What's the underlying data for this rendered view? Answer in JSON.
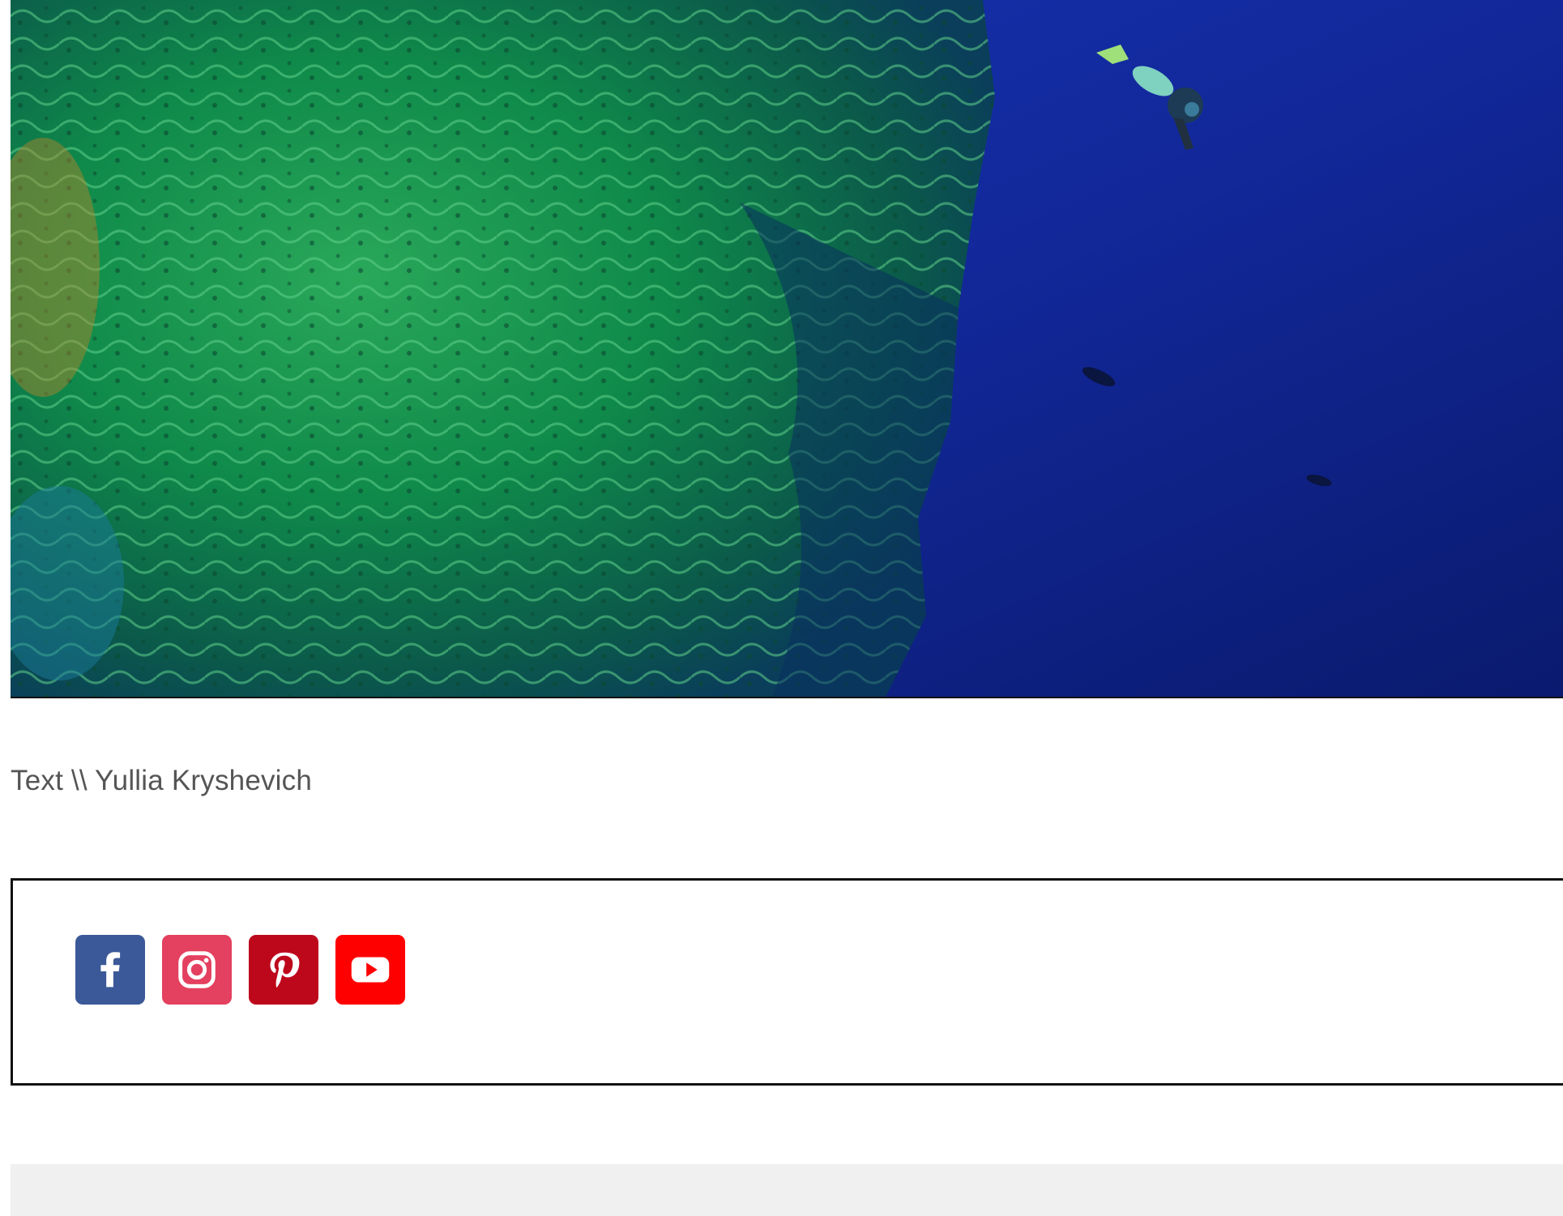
{
  "hero": {
    "alt": "Underwater coral reef wall with a scuba diver in deep blue water"
  },
  "credit": {
    "text": "Text \\\\ Yullia Kryshevich"
  },
  "social": {
    "items": [
      {
        "name": "facebook",
        "icon": "facebook-icon",
        "color": "#3b5998"
      },
      {
        "name": "instagram",
        "icon": "instagram-icon",
        "color": "#e4405f"
      },
      {
        "name": "pinterest",
        "icon": "pinterest-icon",
        "color": "#bd081c"
      },
      {
        "name": "youtube",
        "icon": "youtube-icon",
        "color": "#ff0000"
      }
    ]
  },
  "colors": {
    "text": "#555555",
    "border": "#111111",
    "footer": "#f0f0f0"
  }
}
